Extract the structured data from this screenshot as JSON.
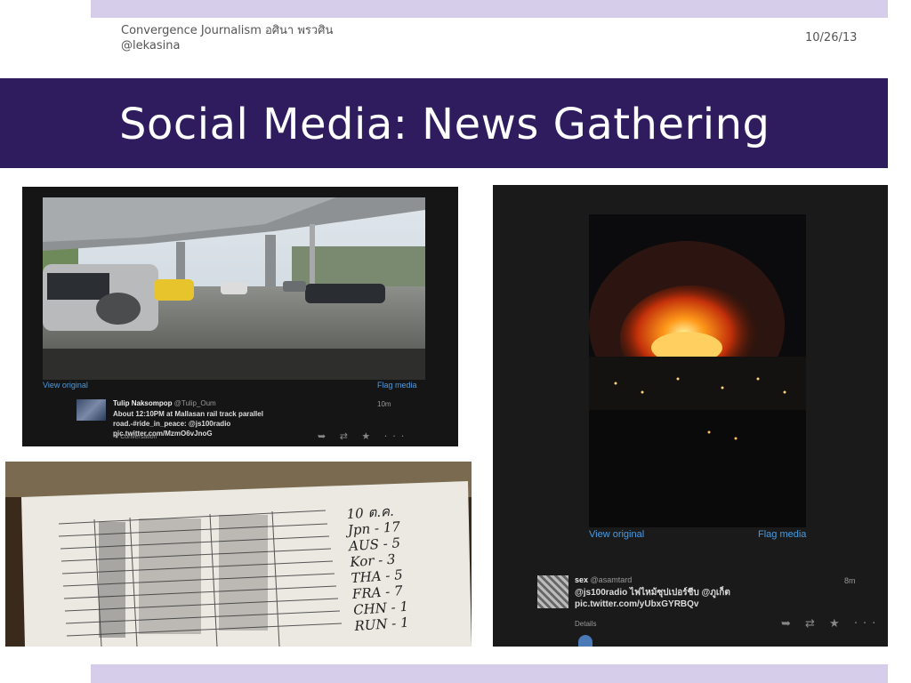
{
  "header": {
    "course": "Convergence Journalism อศินา พรวศิน",
    "handle": "@lekasina",
    "date": "10/26/13"
  },
  "slide": {
    "title": "Social Media: News Gathering"
  },
  "tweet_flood": {
    "view_original": "View original",
    "flag_media": "Flag media",
    "name": "Tulip Naksompop",
    "handle": "@Tulip_Oum",
    "time": "10m",
    "text_line1": "About 12:10PM at Mallasan rail track parallel",
    "text_line2": "road.-#ride_in_peace: @js100radio",
    "text_line3": "pic.twitter.com/MzmO6vJnoG",
    "conversation": "Conversation",
    "actions": "➥ ⇄ ★ ···"
  },
  "paper_note": {
    "heading": "10 ต.ค.",
    "lines": [
      "Jpn - 17",
      "AUS - 5",
      "Kor - 3",
      "THA - 5",
      "FRA - 7",
      "CHN - 1",
      "RUN - 1"
    ]
  },
  "tweet_fire": {
    "view_original": "View original",
    "flag_media": "Flag media",
    "name": "sex",
    "handle": "@asamtard",
    "time": "8m",
    "text_line1": "@js100radio ไฟไหม้ซุปเปอร์ชีบ @ภูเก็ต",
    "text_line2": "pic.twitter.com/yUbxGYRBQv",
    "details": "Details",
    "actions": "➥ ⇄ ★ ···"
  },
  "colors": {
    "title_bar": "#2e1c5e",
    "accent_bars": "#d5cdea",
    "link": "#4a9be0"
  }
}
